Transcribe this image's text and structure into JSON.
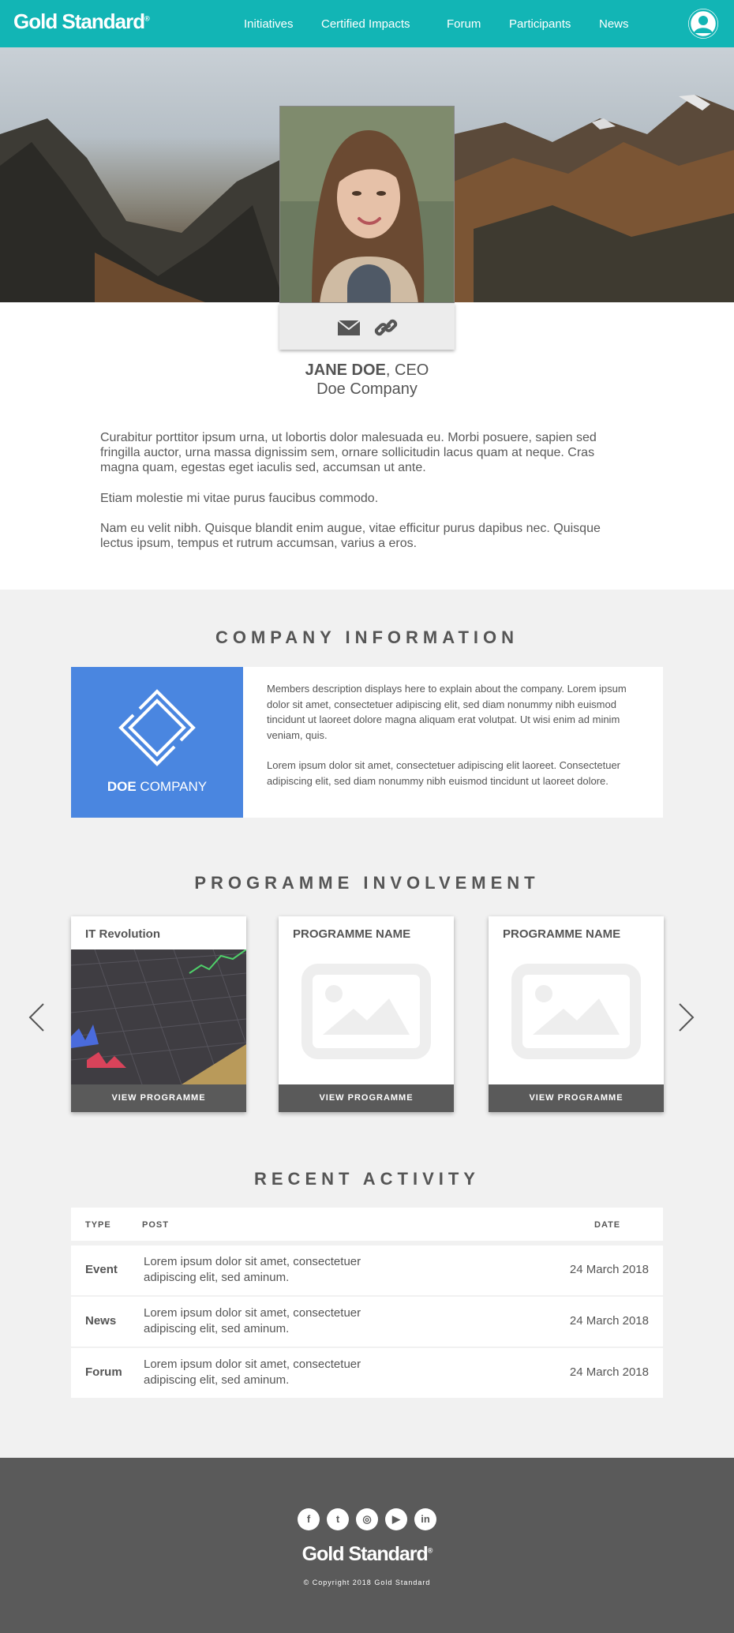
{
  "nav": {
    "logo": "Gold Standard",
    "logo_mark": "®",
    "links": [
      "Initiatives",
      "Certified Impacts",
      "Forum",
      "Participants",
      "News"
    ],
    "avatar_icon": "user-circle-icon"
  },
  "profile": {
    "name": "JANE DOE",
    "role": ", CEO",
    "company": "Doe Company",
    "actions": [
      "envelope-icon",
      "link-icon"
    ],
    "bio": [
      "Curabitur porttitor ipsum urna, ut lobortis dolor malesuada eu. Morbi posuere, sapien sed fringilla auctor, urna massa dignissim sem, ornare sollicitudin lacus quam at neque. Cras magna quam, egestas eget iaculis sed, accumsan ut ante.",
      "Etiam molestie mi vitae purus faucibus commodo.",
      "Nam eu velit nibh. Quisque blandit enim augue, vitae efficitur purus dapibus nec. Quisque lectus ipsum, tempus et rutrum accumsan, varius a eros."
    ]
  },
  "company_info": {
    "title": "COMPANY INFORMATION",
    "logo_bold": "DOE",
    "logo_rest": " COMPANY",
    "logo_color": "#4a86e0",
    "description": [
      "Members description displays here to explain about the company. Lorem ipsum dolor sit amet, consectetuer adipiscing elit, sed diam nonummy nibh euismod tincidunt ut laoreet dolore magna aliquam erat volutpat. Ut wisi enim ad minim veniam, quis.",
      "Lorem ipsum dolor sit amet, consectetuer adipiscing elit laoreet. Consectetuer adipiscing elit, sed diam nonummy nibh euismod tincidunt ut laoreet dolore."
    ]
  },
  "programmes": {
    "title": "PROGRAMME INVOLVEMENT",
    "cards": [
      {
        "title": "IT Revolution",
        "button": "VIEW PROGRAMME"
      },
      {
        "title": "PROGRAMME NAME",
        "button": "VIEW PROGRAMME"
      },
      {
        "title": "PROGRAMME NAME",
        "button": "VIEW PROGRAMME"
      }
    ],
    "prev_icon": "chevron-left-icon",
    "next_icon": "chevron-right-icon"
  },
  "activity": {
    "title": "RECENT ACTIVITY",
    "headers": {
      "type": "TYPE",
      "post": "POST",
      "date": "DATE"
    },
    "rows": [
      {
        "type": "Event",
        "post": "Lorem ipsum dolor sit amet, consectetuer adipiscing elit, sed aminum.",
        "date": "24 March 2018"
      },
      {
        "type": "News",
        "post": "Lorem ipsum dolor sit amet, consectetuer adipiscing elit, sed aminum.",
        "date": "24 March 2018"
      },
      {
        "type": "Forum",
        "post": "Lorem ipsum dolor sit amet, consectetuer adipiscing elit, sed aminum.",
        "date": "24 March 2018"
      }
    ]
  },
  "footer": {
    "social": [
      {
        "icon": "facebook-icon",
        "glyph": "f"
      },
      {
        "icon": "twitter-icon",
        "glyph": "t"
      },
      {
        "icon": "instagram-icon",
        "glyph": "◎"
      },
      {
        "icon": "youtube-icon",
        "glyph": "▶"
      },
      {
        "icon": "linkedin-icon",
        "glyph": "in"
      }
    ],
    "logo": "Gold Standard",
    "copyright": "© Copyright 2018 Gold Standard"
  },
  "colors": {
    "nav": "#12b5b5",
    "footer": "#5a5a5a",
    "section_bg": "#f1f1f1"
  }
}
